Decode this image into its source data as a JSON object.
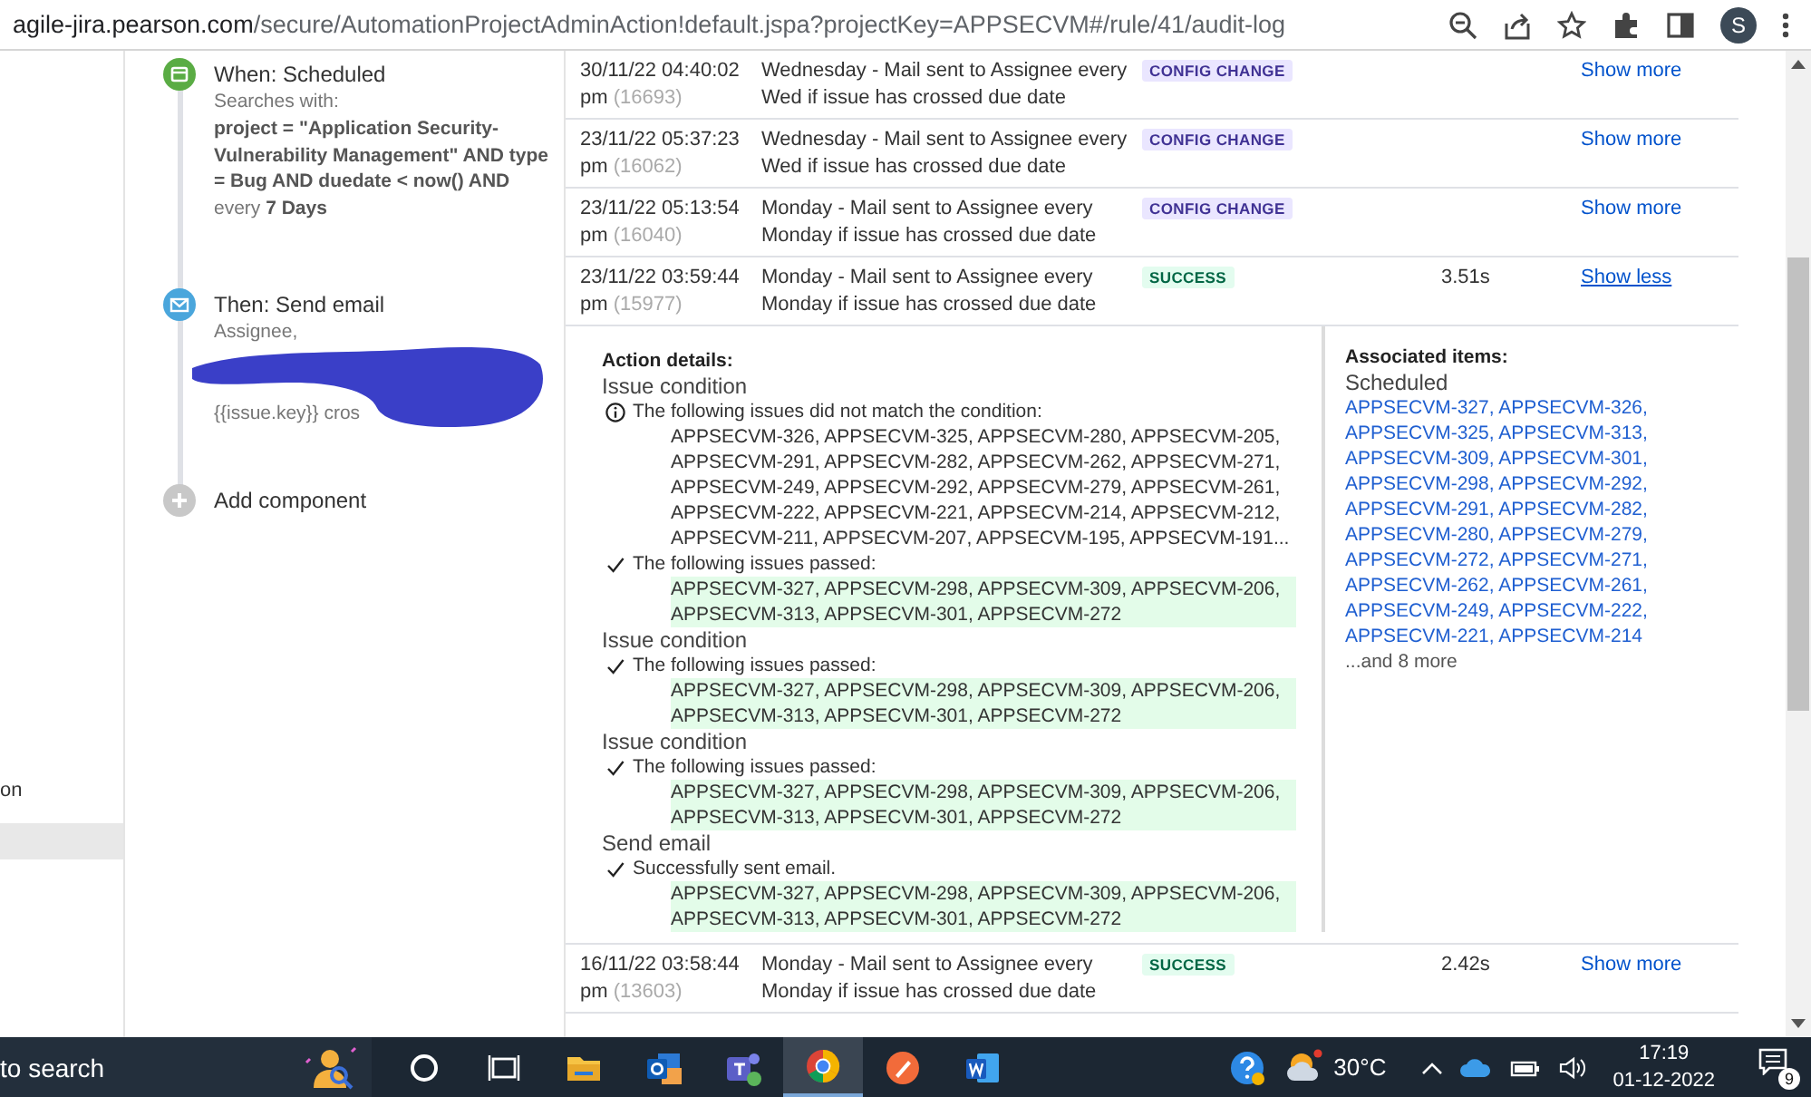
{
  "browser": {
    "url_host": "agile-jira.pearson.com",
    "url_path": "/secure/AutomationProjectAdminAction!default.jspa?projectKey=APPSECVM#/rule/41/audit-log",
    "avatar": "S"
  },
  "sidebar": {
    "items": [
      {
        "label": "on",
        "selected": false
      },
      {
        "selected": true
      }
    ]
  },
  "rule": {
    "components": [
      {
        "kind": "trigger",
        "title": "When: Scheduled",
        "lines": [
          {
            "kind": "muted",
            "text": "Searches with:"
          },
          {
            "kind": "bold",
            "text": "project = \"Application Security-Vulnerability Management\" AND type = Bug AND duedate < now() AND"
          },
          {
            "kind": "muted",
            "text": "every **7 Days**"
          }
        ]
      },
      {
        "kind": "action",
        "title": "Then: Send email",
        "lines": [
          {
            "kind": "muted",
            "text": "Assignee,"
          },
          {
            "kind": "redacted"
          },
          {
            "kind": "muted",
            "text": "{{issue.key}} cros"
          }
        ]
      },
      {
        "kind": "add",
        "title": "Add component"
      }
    ]
  },
  "audit_log": {
    "rows": [
      {
        "time": "30/11/22 04:40:02 pm",
        "id": "(16693)",
        "description": "Wednesday - Mail sent to Assignee every Wed if issue has crossed due date",
        "status": {
          "kind": "config",
          "label": "CONFIG CHANGE"
        },
        "link": "Show more",
        "expanded": false
      },
      {
        "time": "23/11/22 05:37:23 pm",
        "id": "(16062)",
        "description": "Wednesday - Mail sent to Assignee every Wed if issue has crossed due date",
        "status": {
          "kind": "config",
          "label": "CONFIG CHANGE"
        },
        "link": "Show more",
        "expanded": false
      },
      {
        "time": "23/11/22 05:13:54 pm",
        "id": "(16040)",
        "description": "Monday - Mail sent to Assignee every Monday if issue has crossed due date",
        "status": {
          "kind": "config",
          "label": "CONFIG CHANGE"
        },
        "link": "Show more",
        "expanded": false
      },
      {
        "time": "23/11/22 03:59:44 pm",
        "id": "(15977)",
        "description": "Monday - Mail sent to Assignee every Monday if issue has crossed due date",
        "status": {
          "kind": "success",
          "label": "SUCCESS"
        },
        "duration": "3.51s",
        "link": "Show less",
        "expanded": true,
        "details": {
          "title": "Action details:",
          "sections": [
            {
              "title": "Issue condition",
              "results": [
                {
                  "kind": "info",
                  "text": "The following issues did not match the condition:",
                  "issues": "APPSECVM-326, APPSECVM-325, APPSECVM-280, APPSECVM-205, APPSECVM-291, APPSECVM-282, APPSECVM-262, APPSECVM-271, APPSECVM-249, APPSECVM-292, APPSECVM-279, APPSECVM-261, APPSECVM-222, APPSECVM-221, APPSECVM-214, APPSECVM-212, APPSECVM-211, APPSECVM-207, APPSECVM-195, APPSECVM-191...",
                  "highlighted": false
                },
                {
                  "kind": "check",
                  "text": "The following issues passed:",
                  "issues": "APPSECVM-327, APPSECVM-298, APPSECVM-309, APPSECVM-206, APPSECVM-313, APPSECVM-301, APPSECVM-272",
                  "highlighted": true
                }
              ]
            },
            {
              "title": "Issue condition",
              "results": [
                {
                  "kind": "check",
                  "text": "The following issues passed:",
                  "issues": "APPSECVM-327, APPSECVM-298, APPSECVM-309, APPSECVM-206, APPSECVM-313, APPSECVM-301, APPSECVM-272",
                  "highlighted": true
                }
              ]
            },
            {
              "title": "Issue condition",
              "results": [
                {
                  "kind": "check",
                  "text": "The following issues passed:",
                  "issues": "APPSECVM-327, APPSECVM-298, APPSECVM-309, APPSECVM-206, APPSECVM-313, APPSECVM-301, APPSECVM-272",
                  "highlighted": true
                }
              ]
            },
            {
              "title": "Send email",
              "results": [
                {
                  "kind": "check",
                  "text": "Successfully sent email.",
                  "issues": "APPSECVM-327, APPSECVM-298, APPSECVM-309, APPSECVM-206, APPSECVM-313, APPSECVM-301, APPSECVM-272",
                  "highlighted": true
                }
              ]
            }
          ],
          "associated": {
            "title": "Associated items:",
            "subtitle": "Scheduled",
            "separator": ", ",
            "links": [
              "APPSECVM-327",
              "APPSECVM-326",
              "APPSECVM-325",
              "APPSECVM-313",
              "APPSECVM-309",
              "APPSECVM-301",
              "APPSECVM-298",
              "APPSECVM-292",
              "APPSECVM-291",
              "APPSECVM-282",
              "APPSECVM-280",
              "APPSECVM-279",
              "APPSECVM-272",
              "APPSECVM-271",
              "APPSECVM-262",
              "APPSECVM-261",
              "APPSECVM-249",
              "APPSECVM-222",
              "APPSECVM-221",
              "APPSECVM-214"
            ],
            "more": "...and 8 more"
          }
        }
      },
      {
        "time": "16/11/22 03:58:44 pm",
        "id": "(13603)",
        "description": "Monday - Mail sent to Assignee every Monday if issue has crossed due date",
        "status": {
          "kind": "success",
          "label": "SUCCESS"
        },
        "duration": "2.42s",
        "link": "Show more",
        "expanded": false
      }
    ]
  },
  "taskbar": {
    "search": "to search",
    "apps": [
      {
        "kind": "cortana",
        "selected": false
      },
      {
        "kind": "taskview",
        "selected": false
      },
      {
        "kind": "explorer",
        "selected": false
      },
      {
        "kind": "outlook",
        "selected": false
      },
      {
        "kind": "teams",
        "selected": false
      },
      {
        "kind": "chrome",
        "selected": true
      },
      {
        "kind": "pen",
        "selected": false
      },
      {
        "kind": "word",
        "selected": false
      }
    ],
    "temperature": "30°C",
    "time": "17:19",
    "date": "01-12-2022",
    "notifications": "9"
  }
}
